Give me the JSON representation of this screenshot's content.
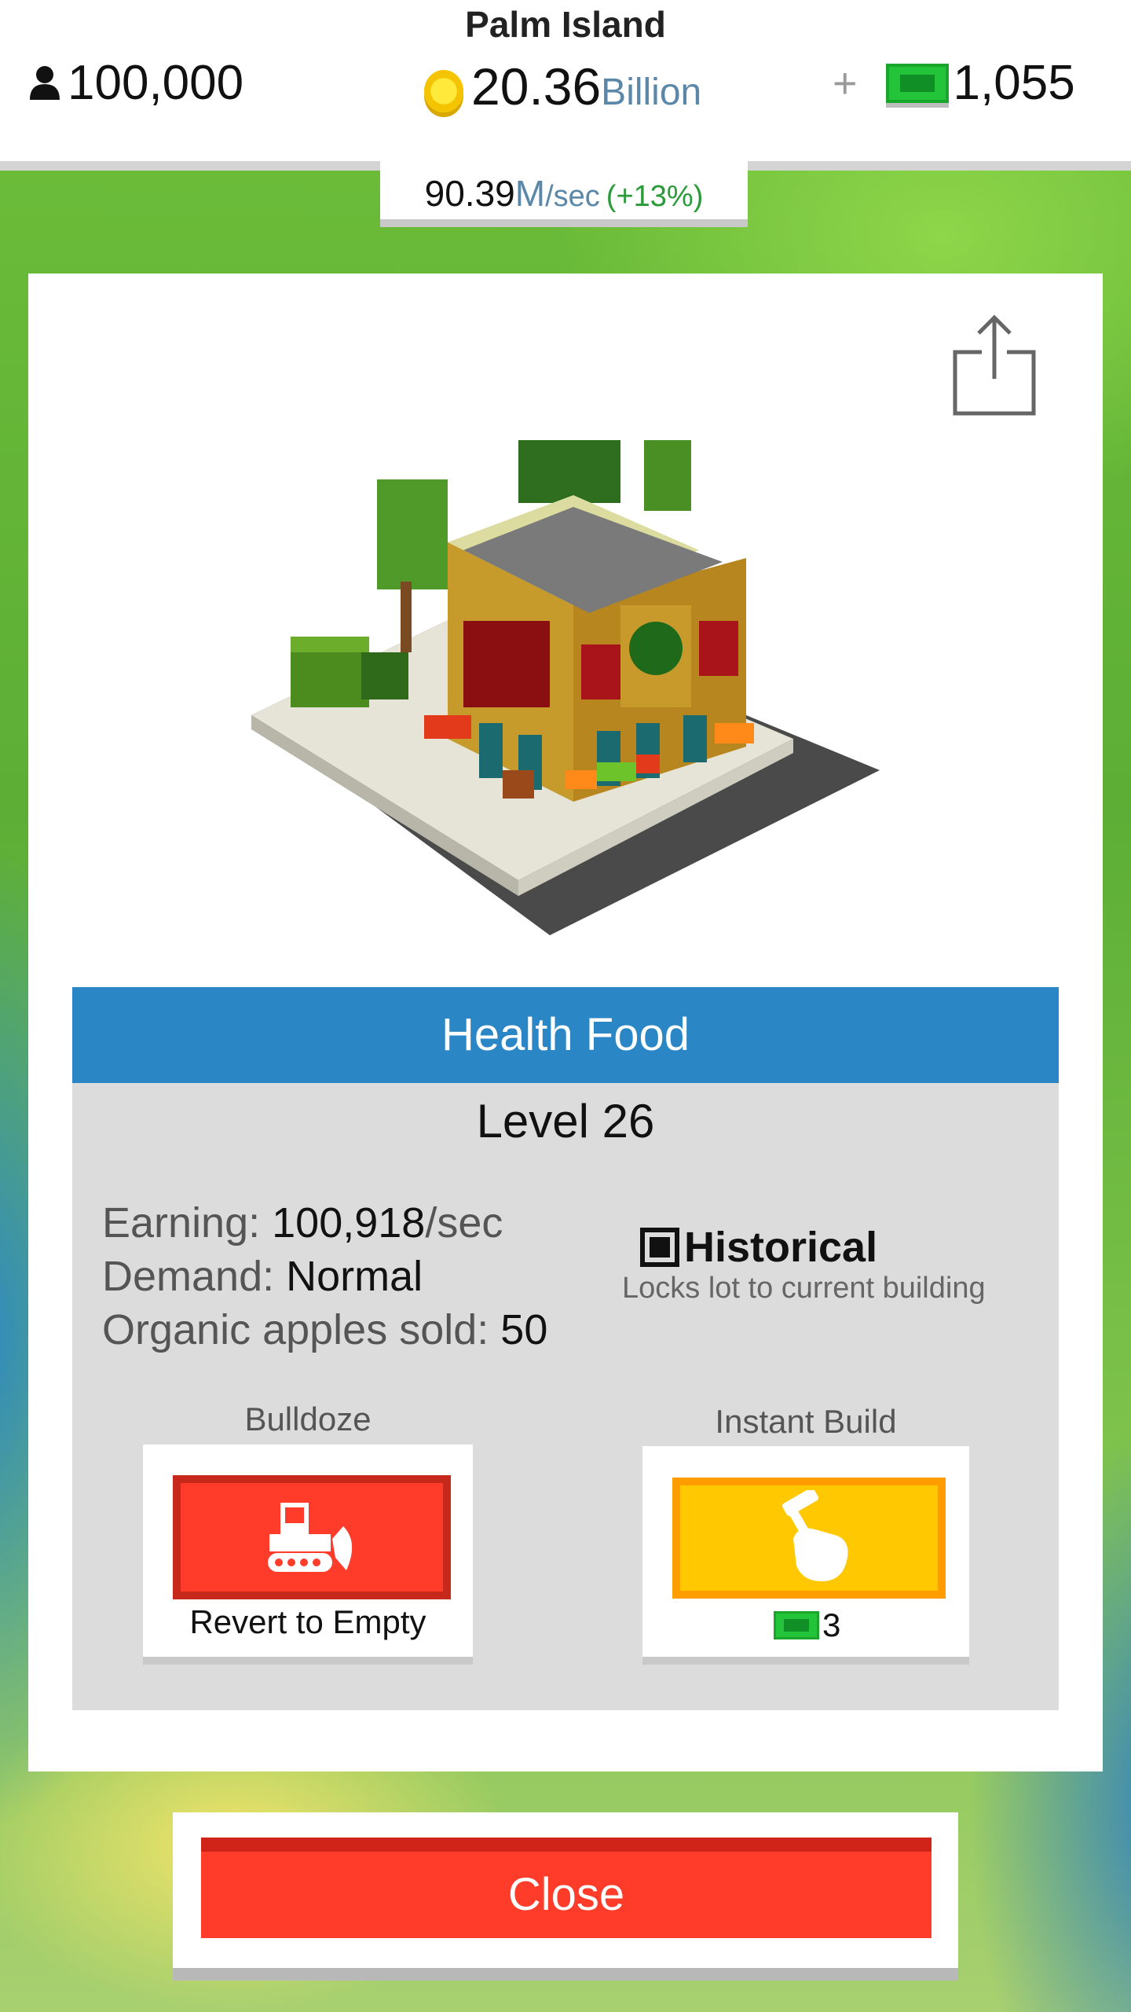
{
  "header": {
    "island_name": "Palm Island",
    "population": "100,000",
    "coins_value": "20.36",
    "coins_unit": "Billion",
    "plus_label": "+",
    "cash_value": "1,055",
    "rate_value": "90.39",
    "rate_unit": "M",
    "rate_suffix": "/sec",
    "rate_bonus": "(+13%)"
  },
  "building": {
    "name": "Health Food",
    "level": "Level 26",
    "earning_label": "Earning: ",
    "earning_value": "100,918",
    "earning_suffix": "/sec",
    "demand_label": "Demand: ",
    "demand_value": "Normal",
    "product_label": "Organic apples sold: ",
    "product_value": "50"
  },
  "historical": {
    "label": "Historical",
    "description": "Locks lot to current building"
  },
  "actions": {
    "bulldoze_label": "Bulldoze",
    "bulldoze_button": "Revert to Empty",
    "instant_label": "Instant Build",
    "instant_cost": "3"
  },
  "footer": {
    "close_label": "Close"
  },
  "icons": {
    "population": "person-icon",
    "coins": "coin-icon",
    "cash": "cash-bill-icon",
    "share": "share-icon",
    "bulldoze": "bulldozer-icon",
    "instant": "hammer-hand-icon"
  },
  "colors": {
    "title_bar": "#2b86c5",
    "bulldoze_button": "#ff3b2a",
    "instant_button": "#ffc800",
    "close_button": "#ff3b2a"
  }
}
